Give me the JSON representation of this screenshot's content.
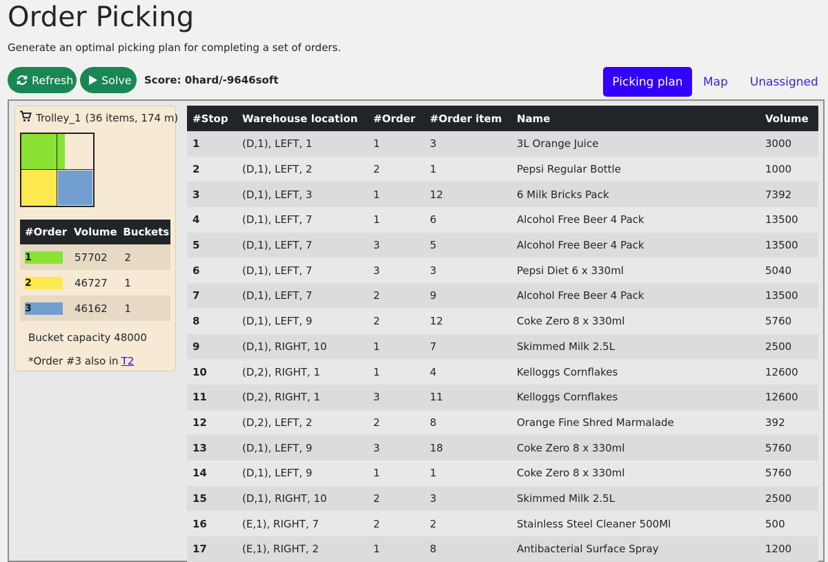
{
  "header": {
    "title": "Order Picking",
    "subtitle": "Generate an optimal picking plan for completing a set of orders."
  },
  "toolbar": {
    "refresh_label": "Refresh",
    "solve_label": "Solve",
    "score": "Score: 0hard/-9646soft"
  },
  "tabs": [
    {
      "label": "Picking plan",
      "active": true
    },
    {
      "label": "Map",
      "active": false
    },
    {
      "label": "Unassigned",
      "active": false
    }
  ],
  "trolley": {
    "name": "Trolley_1",
    "summary": "(36 items, 174 m)",
    "columns": [
      "#Order",
      "Volume",
      "Buckets"
    ],
    "orders": [
      {
        "order": "1",
        "volume": "57702",
        "buckets": "2",
        "color": "#8ae234"
      },
      {
        "order": "2",
        "volume": "46727",
        "buckets": "1",
        "color": "#fce94f"
      },
      {
        "order": "3",
        "volume": "46162",
        "buckets": "1",
        "color": "#729fcf"
      }
    ],
    "bucket_capacity": "Bucket capacity 48000",
    "also_in_text": "*Order #3 also in",
    "also_in_link": "T2"
  },
  "plan": {
    "columns": [
      "#Stop",
      "Warehouse location",
      "#Order",
      "#Order item",
      "Name",
      "Volume"
    ],
    "rows": [
      [
        "1",
        "(D,1), LEFT, 1",
        "1",
        "3",
        "3L Orange Juice",
        "3000"
      ],
      [
        "2",
        "(D,1), LEFT, 2",
        "2",
        "1",
        "Pepsi Regular Bottle",
        "1000"
      ],
      [
        "3",
        "(D,1), LEFT, 3",
        "1",
        "12",
        "6 Milk Bricks Pack",
        "7392"
      ],
      [
        "4",
        "(D,1), LEFT, 7",
        "1",
        "6",
        "Alcohol Free Beer 4 Pack",
        "13500"
      ],
      [
        "5",
        "(D,1), LEFT, 7",
        "3",
        "5",
        "Alcohol Free Beer 4 Pack",
        "13500"
      ],
      [
        "6",
        "(D,1), LEFT, 7",
        "3",
        "3",
        "Pepsi Diet 6 x 330ml",
        "5040"
      ],
      [
        "7",
        "(D,1), LEFT, 7",
        "2",
        "9",
        "Alcohol Free Beer 4 Pack",
        "13500"
      ],
      [
        "8",
        "(D,1), LEFT, 9",
        "2",
        "12",
        "Coke Zero 8 x 330ml",
        "5760"
      ],
      [
        "9",
        "(D,1), RIGHT, 10",
        "1",
        "7",
        "Skimmed Milk 2.5L",
        "2500"
      ],
      [
        "10",
        "(D,2), RIGHT, 1",
        "1",
        "4",
        "Kelloggs Cornflakes",
        "12600"
      ],
      [
        "11",
        "(D,2), RIGHT, 1",
        "3",
        "11",
        "Kelloggs Cornflakes",
        "12600"
      ],
      [
        "12",
        "(D,2), LEFT, 2",
        "2",
        "8",
        "Orange Fine Shred Marmalade",
        "392"
      ],
      [
        "13",
        "(D,1), LEFT, 9",
        "3",
        "18",
        "Coke Zero 8 x 330ml",
        "5760"
      ],
      [
        "14",
        "(D,1), LEFT, 9",
        "1",
        "1",
        "Coke Zero 8 x 330ml",
        "5760"
      ],
      [
        "15",
        "(D,1), RIGHT, 10",
        "2",
        "3",
        "Skimmed Milk 2.5L",
        "2500"
      ],
      [
        "16",
        "(E,1), RIGHT, 7",
        "2",
        "2",
        "Stainless Steel Cleaner 500Ml",
        "500"
      ],
      [
        "17",
        "(E,1), RIGHT, 2",
        "1",
        "8",
        "Antibacterial Surface Spray",
        "1200"
      ]
    ]
  }
}
